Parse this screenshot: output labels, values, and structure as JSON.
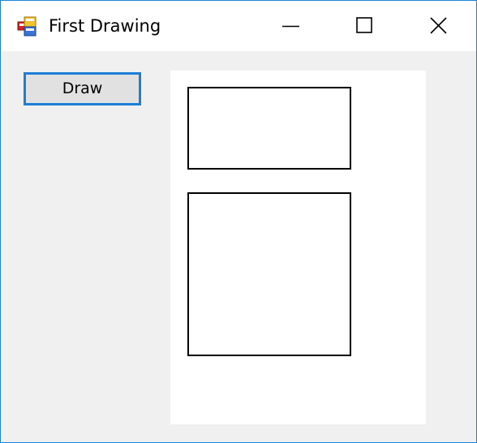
{
  "window": {
    "title": "First Drawing",
    "app_icon": "winforms-app-icon",
    "controls": {
      "minimize_icon": "minimize-icon",
      "maximize_icon": "maximize-icon",
      "close_icon": "close-icon"
    },
    "accent_color": "#1883d7"
  },
  "toolbar": {
    "draw_label": "Draw"
  },
  "canvas": {
    "background": "#ffffff",
    "shapes": [
      "rectangle",
      "square"
    ]
  }
}
